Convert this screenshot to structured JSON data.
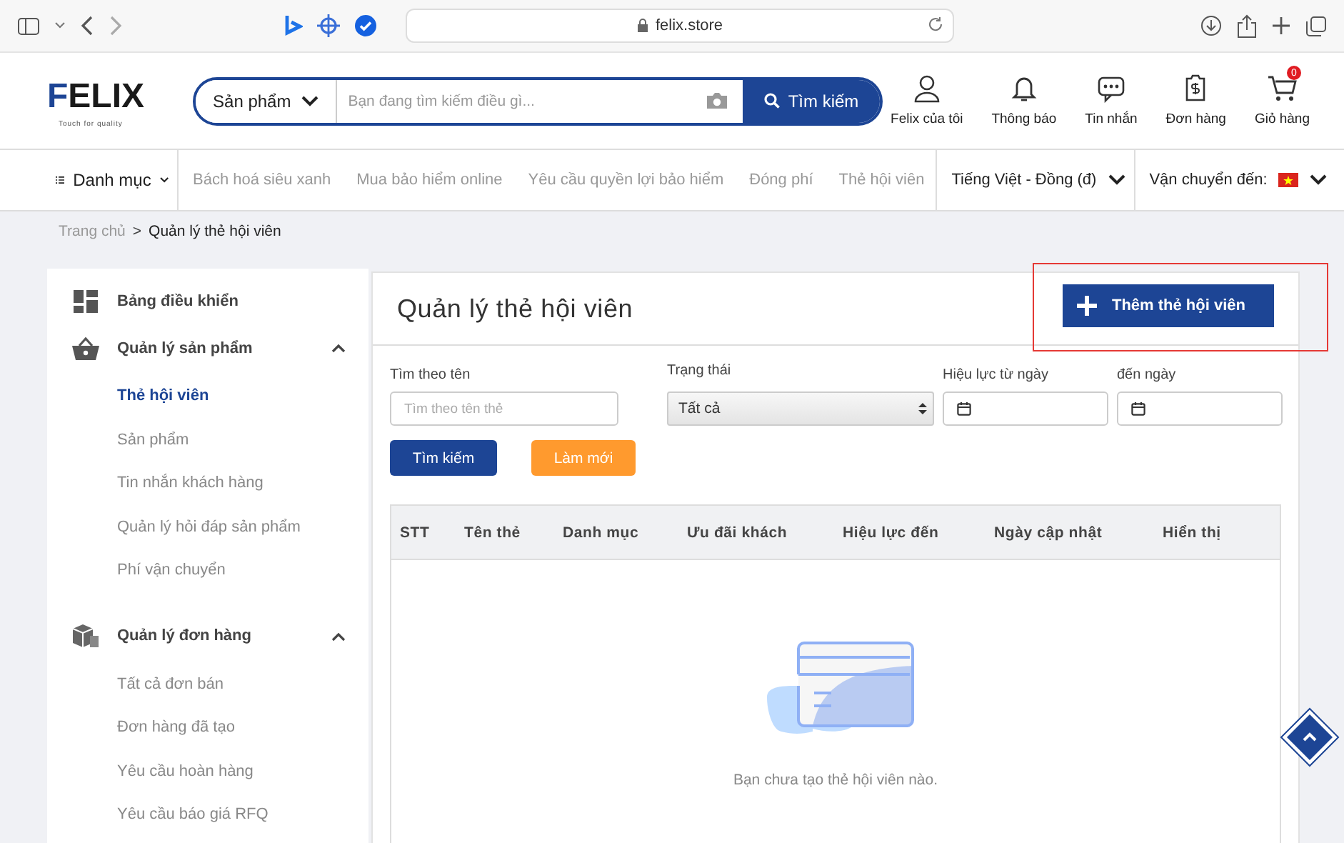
{
  "browser": {
    "url": "felix.store"
  },
  "header": {
    "logo": {
      "word": "FELIX",
      "tagline": "Touch for quality"
    },
    "search": {
      "category": "Sản phẩm",
      "placeholder": "Bạn đang tìm kiếm điều gì...",
      "button": "Tìm kiếm"
    },
    "actions": [
      {
        "kind": "user",
        "label": "Felix của tôi"
      },
      {
        "kind": "bell",
        "label": "Thông báo"
      },
      {
        "kind": "chat",
        "label": "Tin nhắn"
      },
      {
        "kind": "order",
        "label": "Đơn hàng"
      },
      {
        "kind": "cart",
        "label": "Giỏ hàng",
        "badge": "0"
      }
    ]
  },
  "nav": {
    "menu": "Danh mục",
    "links": [
      "Bách hoá siêu xanh",
      "Mua bảo hiểm online",
      "Yêu cầu quyền lợi bảo hiểm",
      "Đóng phí",
      "Thẻ hội viên"
    ],
    "language": "Tiếng Việt - Đồng (đ)",
    "shipping": "Vận chuyển đến:"
  },
  "breadcrumb": {
    "separator": ">",
    "items": [
      {
        "label": "Trang chủ",
        "current": false
      },
      {
        "label": "Quản lý thẻ hội viên",
        "current": true
      }
    ]
  },
  "sidebar": {
    "items": [
      {
        "kind": "dashboard",
        "label": "Bảng điều khiển"
      },
      {
        "kind": "basket",
        "label": "Quản lý sản phẩm",
        "expanded": true,
        "children": [
          {
            "label": "Thẻ hội viên",
            "selected": true
          },
          {
            "label": "Sản phẩm",
            "selected": false
          },
          {
            "label": "Tin nhắn khách hàng",
            "selected": false
          },
          {
            "label": "Quản lý hỏi đáp sản phẩm",
            "selected": false
          },
          {
            "label": "Phí vận chuyển",
            "selected": false
          }
        ]
      },
      {
        "kind": "boxes",
        "label": "Quản lý đơn hàng",
        "expanded": true,
        "children": [
          {
            "label": "Tất cả đơn bán",
            "selected": false
          },
          {
            "label": "Đơn hàng đã tạo",
            "selected": false
          },
          {
            "label": "Yêu cầu hoàn hàng",
            "selected": false
          },
          {
            "label": "Yêu cầu báo giá RFQ",
            "selected": false
          }
        ]
      }
    ]
  },
  "panel": {
    "title": "Quản lý thẻ hội viên",
    "add_button": {
      "label": "Thêm thẻ hội viên",
      "highlighted": true
    },
    "filters": [
      {
        "kind": "text",
        "label": "Tìm theo tên",
        "placeholder": "Tìm theo tên thẻ"
      },
      {
        "kind": "select",
        "label": "Trạng thái",
        "value": "Tất cả"
      },
      {
        "kind": "date",
        "label": "Hiệu lực từ ngày"
      },
      {
        "kind": "date",
        "label": "đến ngày"
      }
    ],
    "buttons": [
      {
        "kind": "primary",
        "label": "Tìm kiếm"
      },
      {
        "kind": "secondary",
        "label": "Làm mới"
      }
    ],
    "table": {
      "columns": [
        "STT",
        "Tên thẻ",
        "Danh mục",
        "Ưu đãi khách",
        "Hiệu lực đến",
        "Ngày cập nhật",
        "Hiển thị"
      ],
      "empty_message": "Bạn chưa tạo thẻ hội viên nào."
    }
  }
}
